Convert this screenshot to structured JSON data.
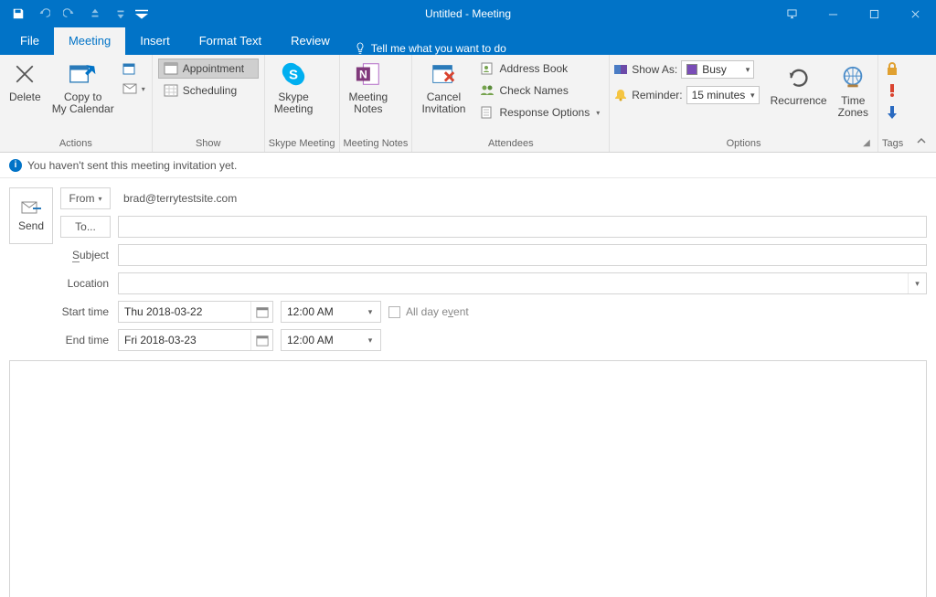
{
  "window": {
    "title": "Untitled  -  Meeting"
  },
  "tabs": {
    "file": "File",
    "meeting": "Meeting",
    "insert": "Insert",
    "format_text": "Format Text",
    "review": "Review",
    "tell_me": "Tell me what you want to do"
  },
  "ribbon": {
    "actions": {
      "delete": "Delete",
      "copy_to_calendar": "Copy to My Calendar",
      "group_label": "Actions"
    },
    "show": {
      "appointment": "Appointment",
      "scheduling": "Scheduling",
      "group_label": "Show"
    },
    "skype": {
      "label": "Skype Meeting",
      "group_label": "Skype Meeting"
    },
    "notes": {
      "label": "Meeting Notes",
      "group_label": "Meeting Notes"
    },
    "attendees": {
      "cancel": "Cancel Invitation",
      "address_book": "Address Book",
      "check_names": "Check Names",
      "response_options": "Response Options",
      "group_label": "Attendees"
    },
    "options": {
      "show_as_label": "Show As:",
      "show_as_value": "Busy",
      "reminder_label": "Reminder:",
      "reminder_value": "15 minutes",
      "recurrence": "Recurrence",
      "time_zones": "Time Zones",
      "group_label": "Options"
    },
    "tags": {
      "group_label": "Tags"
    }
  },
  "info": {
    "message": "You haven't sent this meeting invitation yet."
  },
  "form": {
    "send": "Send",
    "from_label": "From",
    "from_value": "brad@terrytestsite.com",
    "to_label": "To...",
    "to_value": "",
    "subject_label": "Subject",
    "subject_value": "",
    "location_label": "Location",
    "location_value": "",
    "start_label": "Start time",
    "start_date": "Thu 2018-03-22",
    "start_time": "12:00 AM",
    "end_label": "End time",
    "end_date": "Fri 2018-03-23",
    "end_time": "12:00 AM",
    "all_day_label": "All day event",
    "body": ""
  }
}
